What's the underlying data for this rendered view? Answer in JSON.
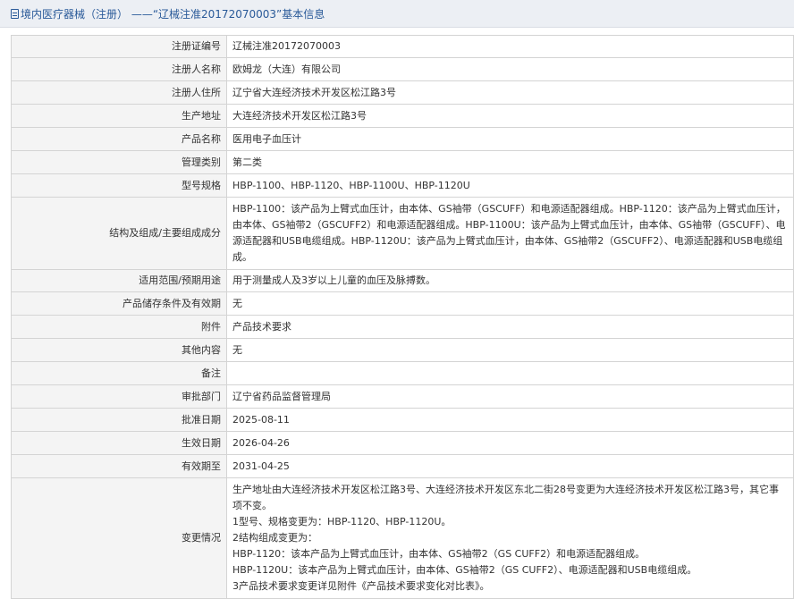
{
  "header": {
    "title": "境内医疗器械（注册） ——“辽械注准20172070003”基本信息"
  },
  "rows": [
    {
      "label": "注册证编号",
      "value": "辽械注准20172070003"
    },
    {
      "label": "注册人名称",
      "value": "欧姆龙（大连）有限公司"
    },
    {
      "label": "注册人住所",
      "value": "辽宁省大连经济技术开发区松江路3号"
    },
    {
      "label": "生产地址",
      "value": "大连经济技术开发区松江路3号"
    },
    {
      "label": "产品名称",
      "value": "医用电子血压计"
    },
    {
      "label": "管理类别",
      "value": "第二类"
    },
    {
      "label": "型号规格",
      "value": "HBP-1100、HBP-1120、HBP-1100U、HBP-1120U"
    },
    {
      "label": "结构及组成/主要组成成分",
      "value": "HBP-1100：该产品为上臂式血压计，由本体、GS袖带（GSCUFF）和电源适配器组成。HBP-1120：该产品为上臂式血压计，由本体、GS袖带2（GSCUFF2）和电源适配器组成。HBP-1100U：该产品为上臂式血压计，由本体、GS袖带（GSCUFF）、电源适配器和USB电缆组成。HBP-1120U：该产品为上臂式血压计，由本体、GS袖带2（GSCUFF2）、电源适配器和USB电缆组成。"
    },
    {
      "label": "适用范围/预期用途",
      "value": "用于测量成人及3岁以上儿童的血压及脉搏数。"
    },
    {
      "label": "产品储存条件及有效期",
      "value": "无"
    },
    {
      "label": "附件",
      "value": "产品技术要求"
    },
    {
      "label": "其他内容",
      "value": "无"
    },
    {
      "label": "备注",
      "value": ""
    },
    {
      "label": "审批部门",
      "value": "辽宁省药品监督管理局"
    },
    {
      "label": "批准日期",
      "value": "2025-08-11"
    },
    {
      "label": "生效日期",
      "value": "2026-04-26"
    },
    {
      "label": "有效期至",
      "value": "2031-04-25"
    }
  ],
  "changes": {
    "label": "变更情况",
    "lines": [
      "生产地址由大连经济技术开发区松江路3号、大连经济技术开发区东北二街28号变更为大连经济技术开发区松江路3号，其它事项不变。",
      "1型号、规格变更为：HBP-1120、HBP-1120U。",
      "2结构组成变更为：",
      "HBP-1120：该本产品为上臂式血压计，由本体、GS袖带2（GS CUFF2）和电源适配器组成。",
      "HBP-1120U：该本产品为上臂式血压计，由本体、GS袖带2（GS CUFF2）、电源适配器和USB电缆组成。",
      "3产品技术要求变更详见附件《产品技术要求变化对比表》。"
    ]
  }
}
